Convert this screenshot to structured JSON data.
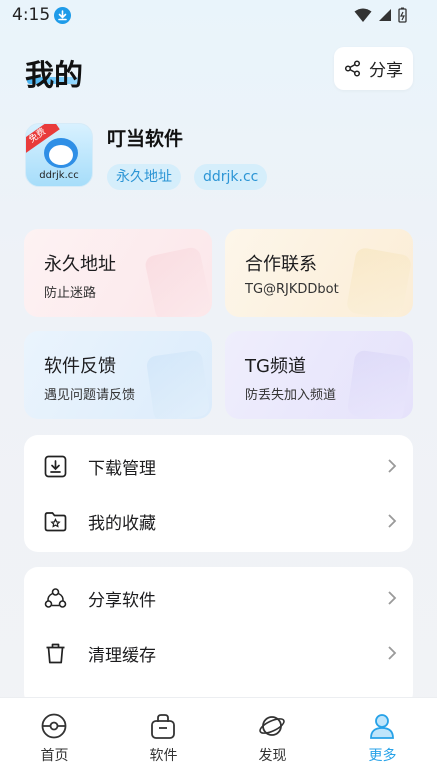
{
  "status": {
    "time": "4:15"
  },
  "header": {
    "title": "我的",
    "share_label": "分享"
  },
  "profile": {
    "name": "叮当软件",
    "avatar_text": "ddrjk.cc",
    "avatar_badge": "免费",
    "tags": [
      "永久地址",
      "ddrjk.cc"
    ]
  },
  "cards": [
    {
      "title": "永久地址",
      "subtitle": "防止迷路"
    },
    {
      "title": "合作联系",
      "subtitle": "TG@RJKDDbot"
    },
    {
      "title": "软件反馈",
      "subtitle": "遇见问题请反馈"
    },
    {
      "title": "TG频道",
      "subtitle": "防丢失加入频道"
    }
  ],
  "menu_group_1": [
    {
      "label": "下载管理",
      "icon": "download-icon"
    },
    {
      "label": "我的收藏",
      "icon": "folder-star-icon"
    }
  ],
  "menu_group_2": [
    {
      "label": "分享软件",
      "icon": "share-nodes-icon"
    },
    {
      "label": "清理缓存",
      "icon": "trash-icon"
    }
  ],
  "bottom_nav": [
    {
      "label": "首页",
      "icon": "home-icon",
      "active": false
    },
    {
      "label": "软件",
      "icon": "basket-icon",
      "active": false
    },
    {
      "label": "发现",
      "icon": "planet-icon",
      "active": false
    },
    {
      "label": "更多",
      "icon": "user-icon",
      "active": true
    }
  ],
  "colors": {
    "accent": "#27a2e8",
    "tag_bg": "#d5eefb",
    "tag_text": "#2c95d5"
  }
}
